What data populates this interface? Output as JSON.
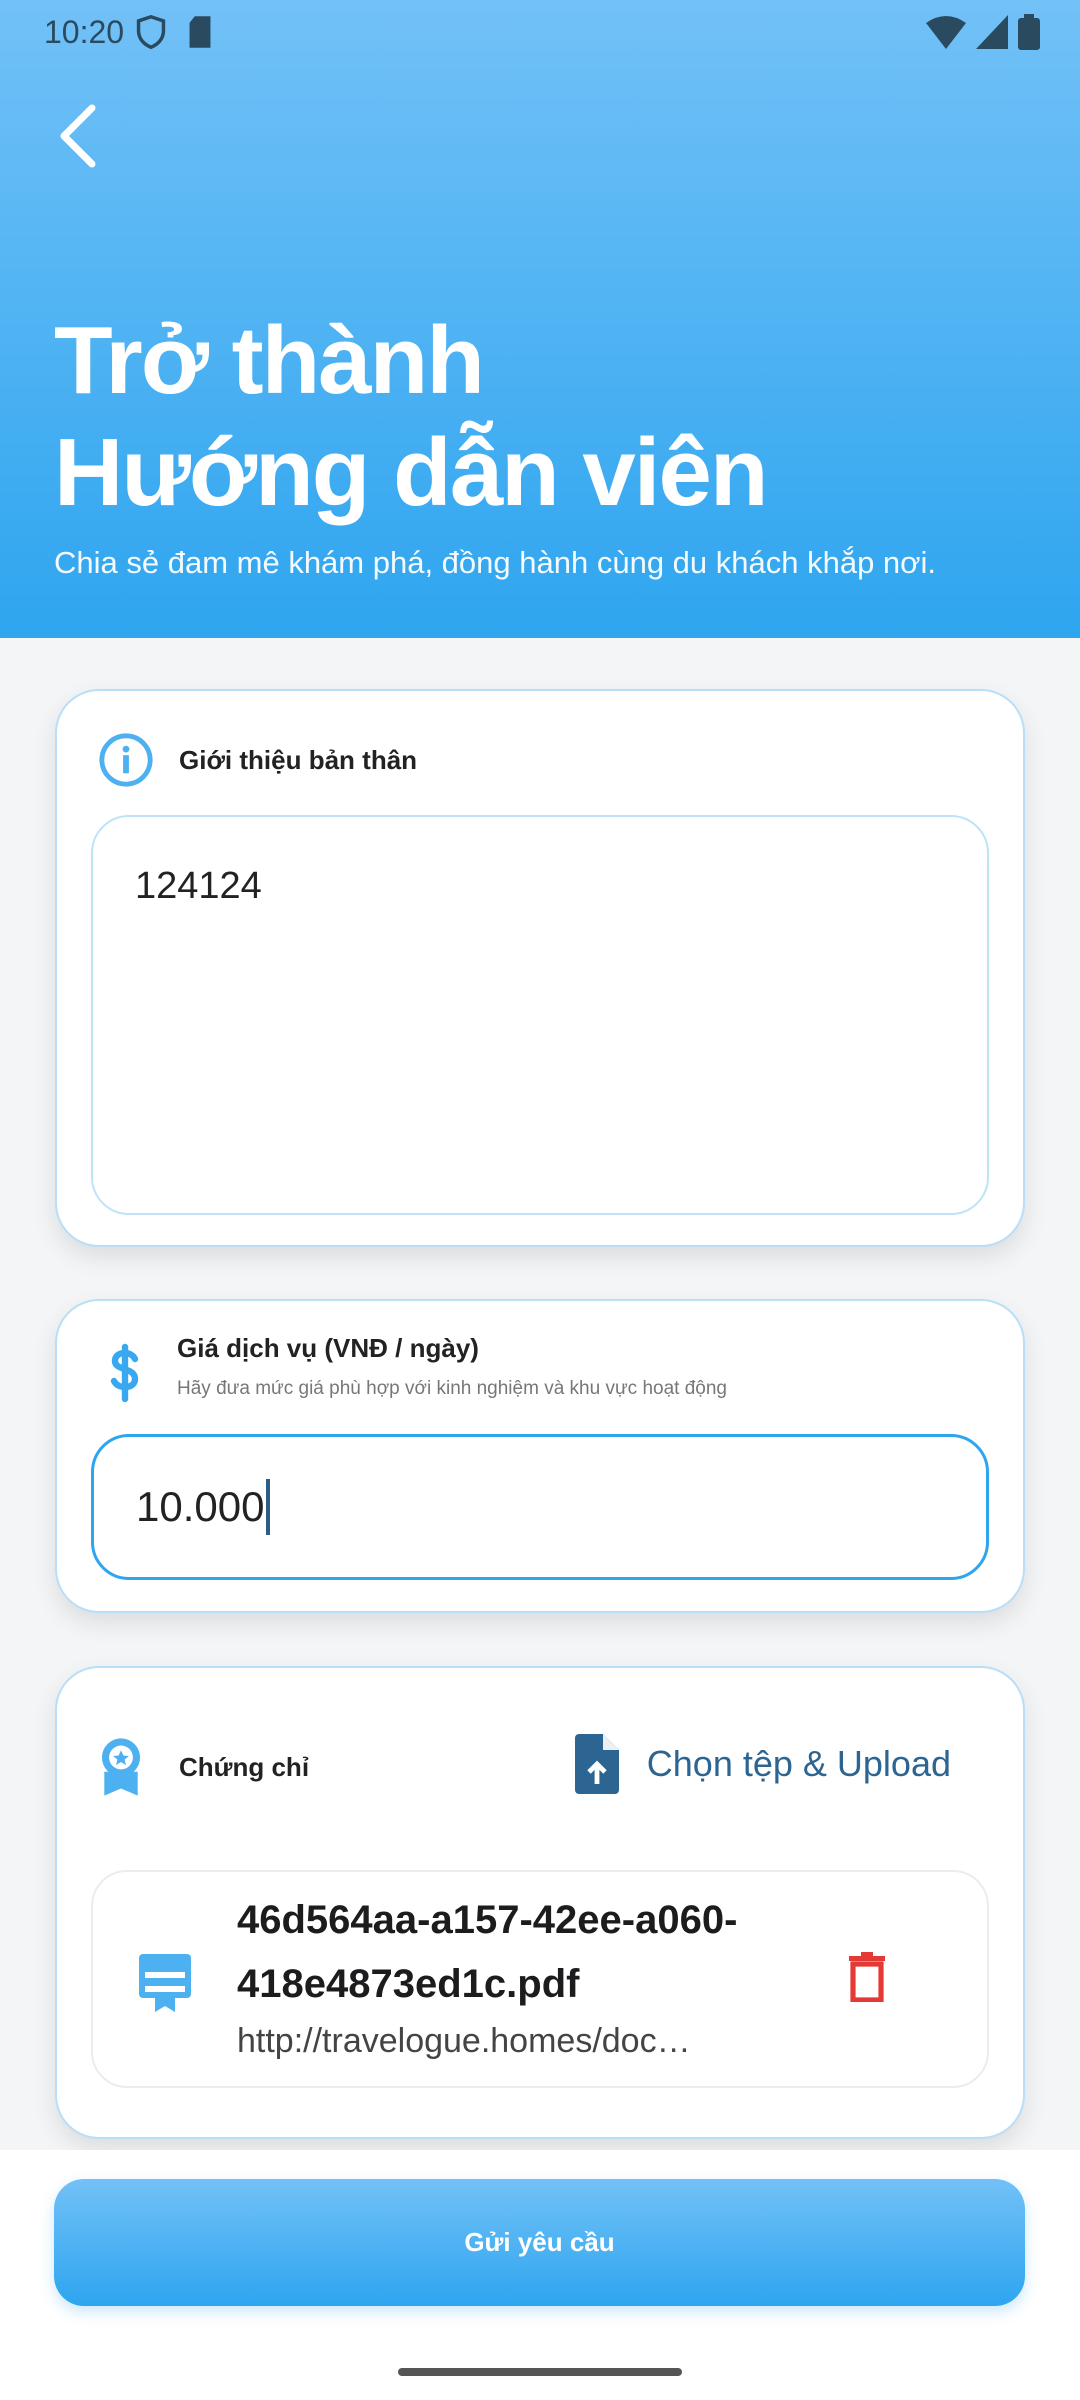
{
  "status_bar": {
    "time": "10:20"
  },
  "header": {
    "title_line1": "Trở thành",
    "title_line2": "Hướng dẫn viên",
    "subtitle": "Chia sẻ đam mê khám phá, đồng hành cùng du khách khắp nơi."
  },
  "intro": {
    "label": "Giới thiệu bản thân",
    "value": "124124"
  },
  "price": {
    "label": "Giá dịch vụ (VNĐ / ngày)",
    "hint": "Hãy đưa mức giá phù hợp với kinh nghiệm và khu vực hoạt động",
    "value": "10.000"
  },
  "certificates": {
    "label": "Chứng chỉ",
    "upload_label": "Chọn tệp & Upload",
    "files": [
      {
        "name": "46d564aa-a157-42ee-a060-418e4873ed1c.pdf",
        "url": "http://travelogue.homes/doc…"
      }
    ]
  },
  "submit_label": "Gửi yêu cầu",
  "colors": {
    "primary": "#2ea5ef",
    "delete": "#e53935",
    "upload": "#2c6592"
  }
}
